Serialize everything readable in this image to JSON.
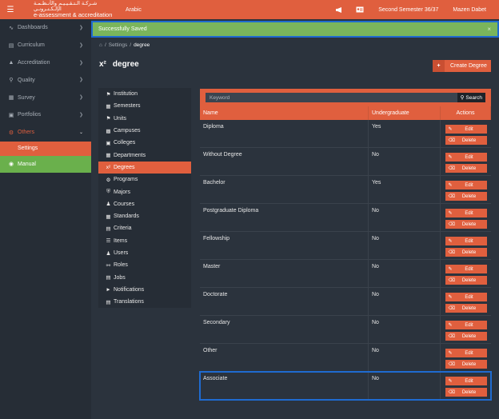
{
  "topbar": {
    "logo_arabic": "شـركـة الـتـقـيـيـم والأنـظـمـة الإلـكـتـرونـي",
    "logo_english": "e-assessment & accreditation",
    "language": "Arabic",
    "semester": "Second Semester 36/37",
    "user": "Mazen Dabet",
    "icons": [
      "menu-icon",
      "megaphone-icon",
      "id-card-icon"
    ]
  },
  "sidebar": {
    "items": [
      {
        "label": "Dashboards",
        "icon": "pulse-icon"
      },
      {
        "label": "Curriculum",
        "icon": "book-icon"
      },
      {
        "label": "Accreditation",
        "icon": "sitemap-icon"
      },
      {
        "label": "Quality",
        "icon": "search-icon"
      },
      {
        "label": "Survey",
        "icon": "calendar-icon"
      },
      {
        "label": "Portfolios",
        "icon": "briefcase-icon"
      },
      {
        "label": "Others",
        "icon": "cogs-icon"
      }
    ],
    "active_sub": "Settings",
    "manual": "Manual"
  },
  "alert": {
    "message": "Successfully Saved",
    "close": "×"
  },
  "breadcrumb": {
    "sep": "/",
    "settings": "Settings",
    "current": "degree"
  },
  "page": {
    "title_icon": "x²",
    "title": "degree",
    "create_label": "Create Degree",
    "create_icon": "+"
  },
  "settings_menu": [
    {
      "label": "Institution",
      "icon": "bank-icon"
    },
    {
      "label": "Semesters",
      "icon": "calendar-icon"
    },
    {
      "label": "Units",
      "icon": "bank-icon"
    },
    {
      "label": "Campuses",
      "icon": "building-icon"
    },
    {
      "label": "Colleges",
      "icon": "briefcase-icon"
    },
    {
      "label": "Departments",
      "icon": "grid-icon"
    },
    {
      "label": "Degrees",
      "icon": "superscript-icon",
      "active": true
    },
    {
      "label": "Programs",
      "icon": "cogs-icon"
    },
    {
      "label": "Majors",
      "icon": "shield-icon"
    },
    {
      "label": "Courses",
      "icon": "teacher-icon"
    },
    {
      "label": "Standards",
      "icon": "grid-icon"
    },
    {
      "label": "Criteria",
      "icon": "table-icon"
    },
    {
      "label": "Items",
      "icon": "list-icon"
    },
    {
      "label": "Users",
      "icon": "users-icon"
    },
    {
      "label": "Roles",
      "icon": "key-icon"
    },
    {
      "label": "Jobs",
      "icon": "book-icon"
    },
    {
      "label": "Notifications",
      "icon": "bullhorn-icon"
    },
    {
      "label": "Translations",
      "icon": "language-icon"
    }
  ],
  "table": {
    "search_placeholder": "Keyword",
    "search_label": "Search",
    "headers": {
      "name": "Name",
      "undergraduate": "Undergraduate",
      "actions": "Actions"
    },
    "edit_label": "Edit",
    "delete_label": "Delete",
    "rows": [
      {
        "name": "Diploma",
        "undergraduate": "Yes"
      },
      {
        "name": "Without Degree",
        "undergraduate": "No"
      },
      {
        "name": "Bachelor",
        "undergraduate": "Yes"
      },
      {
        "name": "Postgraduate Diploma",
        "undergraduate": "No"
      },
      {
        "name": "Fellowship",
        "undergraduate": "No"
      },
      {
        "name": "Master",
        "undergraduate": "No"
      },
      {
        "name": "Doctorate",
        "undergraduate": "No"
      },
      {
        "name": "Secondary",
        "undergraduate": "No"
      },
      {
        "name": "Other",
        "undergraduate": "No"
      },
      {
        "name": "Associate",
        "undergraduate": "No",
        "highlighted": true
      }
    ]
  },
  "colors": {
    "accent": "#e05f3e",
    "success": "#7ab55c",
    "manual": "#6ab04c",
    "highlight": "#1f6bd0",
    "background": "#2b333d"
  }
}
